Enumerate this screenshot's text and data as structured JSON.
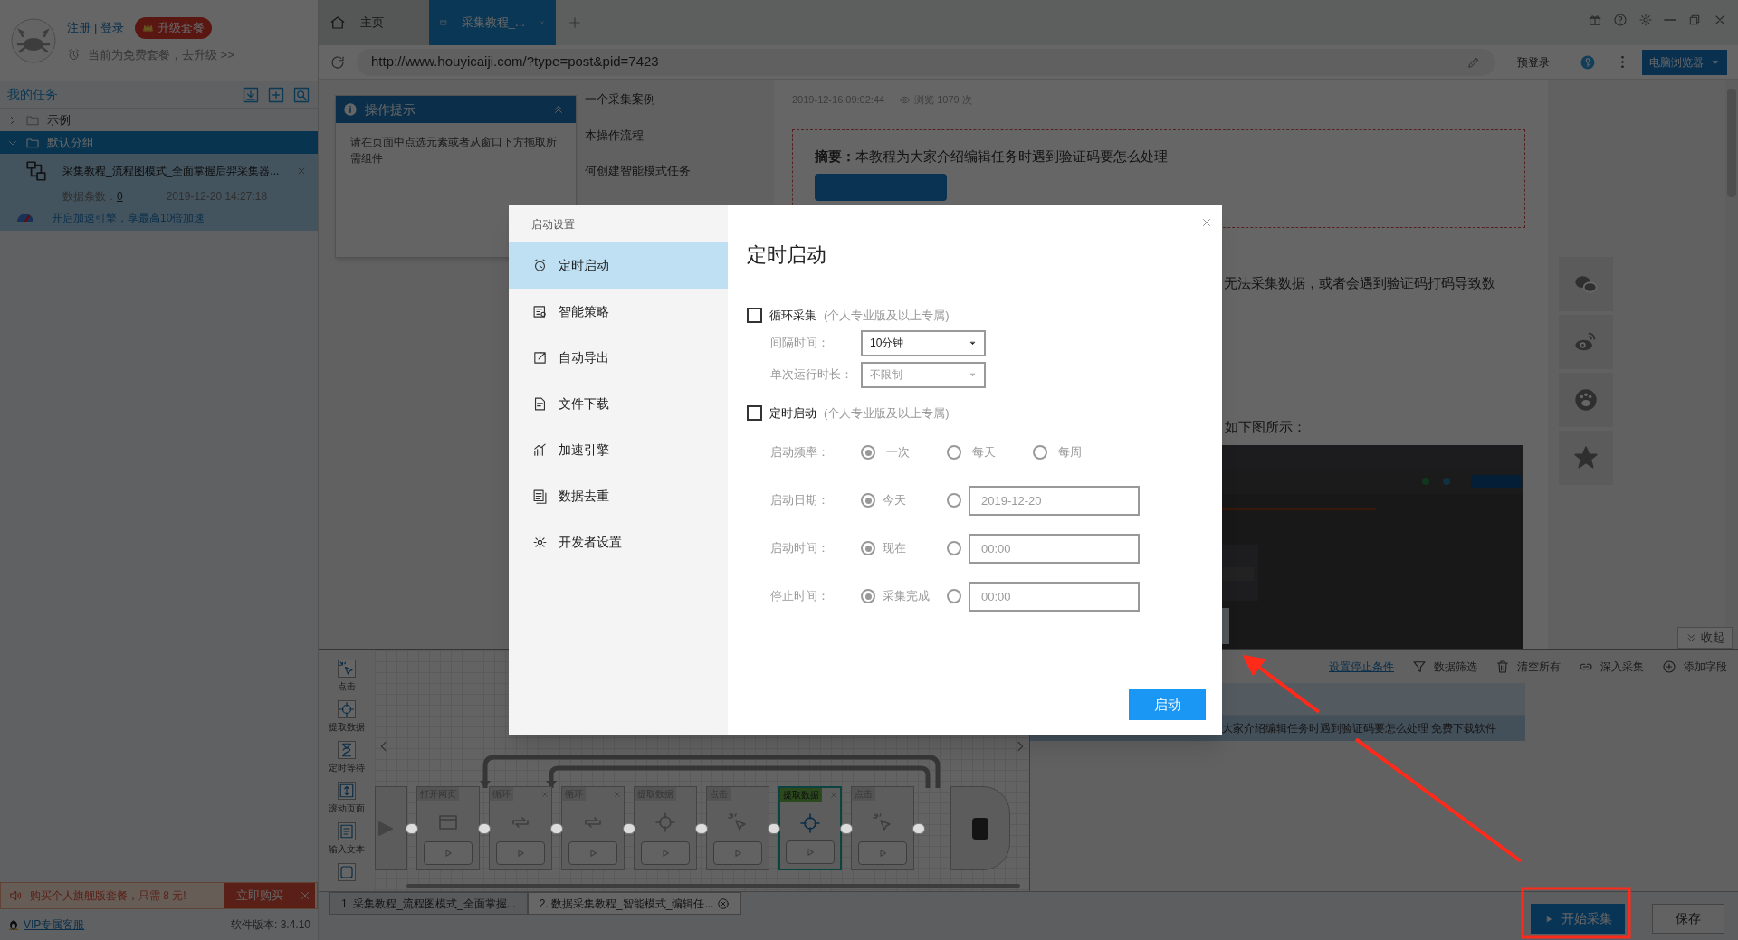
{
  "account": {
    "links": [
      "注册",
      "登录"
    ],
    "separator": "|",
    "upgrade": "升级套餐",
    "plan_note": "当前为免费套餐，去升级 >>"
  },
  "task_panel": {
    "title": "我的任务",
    "groups": [
      {
        "label": "示例",
        "expanded": false,
        "selected": false
      },
      {
        "label": "默认分组",
        "expanded": true,
        "selected": true,
        "children": [
          {
            "title": "采集教程_流程图模式_全面掌握后羿采集器...",
            "count_label": "数据条数：",
            "count": "0",
            "time": "2019-12-20 14:27:18",
            "boost": "开启加速引擎，享最高10倍加速"
          }
        ]
      }
    ]
  },
  "promo": {
    "text": "购买个人旗舰版套餐，只需 8 元!",
    "button": "立即购买"
  },
  "footer": {
    "support": "VIP专属客服",
    "version": "软件版本: 3.4.10"
  },
  "browser_tabs": [
    {
      "kind": "home",
      "label": "主页",
      "selected": false,
      "closable": false
    },
    {
      "kind": "page",
      "label": "采集教程_...",
      "selected": true,
      "closable": true
    }
  ],
  "address_bar": {
    "url": "http://www.houyicaiji.com/?type=post&pid=7423",
    "pre_login": "预登录",
    "mode": "电脑浏览器"
  },
  "page": {
    "toc": [
      "一个采集案例",
      "本操作流程",
      "何创建智能模式任务"
    ],
    "hint": {
      "title": "操作提示",
      "body": "请在页面中点选元素或者从窗口下方拖取所需组件"
    },
    "date": "2019-12-16 09:02:44",
    "views": "浏览 1079 次",
    "summary": "**摘要：**本教程为大家介绍编辑任务时遇到验证码要怎么处理",
    "paragraph": "无法采集数据，或者会遇到验证码打码导致数",
    "caption": "如下图所示：",
    "figure": {
      "kind": "picture"
    },
    "share": [
      {
        "kind": "wechat"
      },
      {
        "kind": "weibo"
      },
      {
        "kind": "paw"
      },
      {
        "kind": "star"
      }
    ]
  },
  "collapse": "收起",
  "toolbox": [
    {
      "kind": "click",
      "label": "点击"
    },
    {
      "kind": "extract",
      "label": "提取数据"
    },
    {
      "kind": "wait",
      "label": "定时等待"
    },
    {
      "kind": "scroll",
      "label": "滚动页面"
    },
    {
      "kind": "input",
      "label": "输入文本"
    },
    {
      "kind": "more"
    }
  ],
  "flow": [
    {
      "kind": "open",
      "label": "打开网页",
      "selected": false,
      "closable": false
    },
    {
      "kind": "loop",
      "label": "循环",
      "selected": false,
      "closable": true
    },
    {
      "kind": "loop",
      "label": "循环",
      "selected": false,
      "closable": true
    },
    {
      "kind": "extract",
      "label": "提取数据",
      "selected": false,
      "closable": false
    },
    {
      "kind": "click",
      "label": "点击",
      "selected": false,
      "closable": false
    },
    {
      "kind": "extract",
      "label": "提取数据",
      "selected": true,
      "closable": true
    },
    {
      "kind": "click",
      "label": "点击",
      "selected": false,
      "closable": false
    }
  ],
  "data_panel": {
    "stop_condition": "设置停止条件",
    "actions": [
      {
        "kind": "filter",
        "label": "数据筛选"
      },
      {
        "kind": "clear",
        "label": "清空所有"
      },
      {
        "kind": "deep",
        "label": "深入采集"
      },
      {
        "kind": "add",
        "label": "添加字段"
      }
    ],
    "row_text": "大家介绍编辑任务时遇到验证码要怎么处理 免费下载软件"
  },
  "task_tabs": [
    {
      "label": "1. 采集教程_流程图模式_全面掌握...",
      "selected": false,
      "closable": false
    },
    {
      "label": "2. 数据采集教程_智能模式_编辑任...",
      "selected": true,
      "closable": true
    }
  ],
  "actions": {
    "start": "开始采集",
    "save": "保存"
  },
  "dialog": {
    "title": "启动设置",
    "nav": [
      {
        "kind": "alarm",
        "label": "定时启动",
        "selected": true
      },
      {
        "kind": "strategy",
        "label": "智能策略",
        "selected": false
      },
      {
        "kind": "export",
        "label": "自动导出",
        "selected": false
      },
      {
        "kind": "file",
        "label": "文件下载",
        "selected": false
      },
      {
        "kind": "chart",
        "label": "加速引擎",
        "selected": false
      },
      {
        "kind": "dedupe",
        "label": "数据去重",
        "selected": false
      },
      {
        "kind": "gear",
        "label": "开发者设置",
        "selected": false
      }
    ],
    "heading": "定时启动",
    "loop": {
      "label": "循环采集",
      "note": "(个人专业版及以上专属)",
      "checked": false,
      "fields": [
        {
          "label": "间隔时间：",
          "value": "10分钟",
          "disabled": false
        },
        {
          "label": "单次运行时长：",
          "value": "不限制",
          "disabled": true
        }
      ]
    },
    "schedule": {
      "label": "定时启动",
      "note": "(个人专业版及以上专属)",
      "checked": false,
      "frequency": {
        "label": "启动频率：",
        "options": [
          {
            "label": "一次",
            "selected": true
          },
          {
            "label": "每天",
            "selected": false
          },
          {
            "label": "每周",
            "selected": false
          }
        ]
      },
      "rows": [
        {
          "label": "启动日期：",
          "option": "今天",
          "selected": true,
          "value": "2019-12-20"
        },
        {
          "label": "启动时间：",
          "option": "现在",
          "selected": true,
          "value": "00:00"
        },
        {
          "label": "停止时间：",
          "option": "采集完成",
          "selected": true,
          "value": "00:00"
        }
      ]
    },
    "submit": "启动"
  }
}
